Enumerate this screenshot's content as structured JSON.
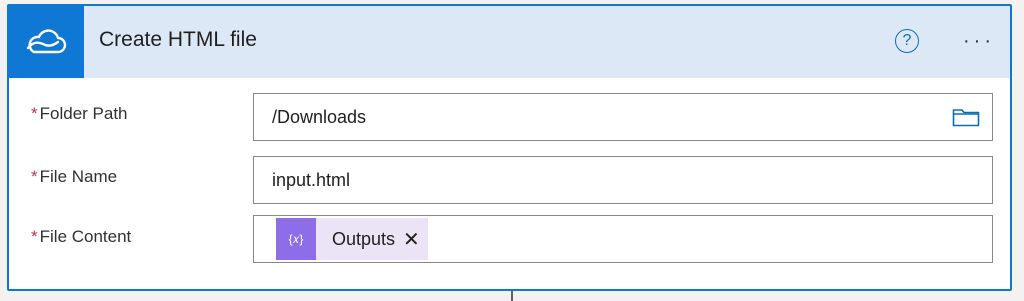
{
  "header": {
    "title": "Create HTML file",
    "icon": "onedrive-cloud-icon",
    "help_glyph": "?",
    "more_glyph": "···"
  },
  "fields": {
    "folder_path": {
      "label": "Folder Path",
      "required_mark": "*",
      "value": "/Downloads",
      "icon": "folder-icon"
    },
    "file_name": {
      "label": "File Name",
      "required_mark": "*",
      "value": "input.html"
    },
    "file_content": {
      "label": "File Content",
      "required_mark": "*",
      "token": {
        "icon_glyph": "{𝑥}",
        "label": "Outputs",
        "remove_glyph": "✕"
      }
    }
  },
  "colors": {
    "accent": "#0f78d4",
    "header_bg": "#dde8f6",
    "required": "#c4314b",
    "token_icon_bg": "#8e6ee8",
    "token_bg": "#ebe4f7"
  }
}
